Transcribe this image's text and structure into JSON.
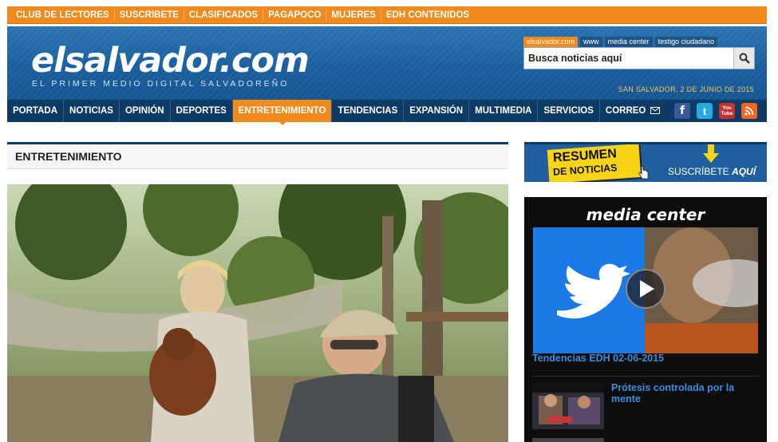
{
  "topbar": {
    "links": [
      "CLUB DE LECTORES",
      "SUSCRIBETE",
      "CLASIFICADOS",
      "PAGAPOCO",
      "MUJERES",
      "EDH CONTENIDOS"
    ]
  },
  "header": {
    "logo": "elsalvador.com",
    "slogan": "EL PRIMER MEDIO DIGITAL SALVADOREÑO",
    "site_tabs": [
      "elsalvador.com",
      "www",
      "media center",
      "testigo ciudadano"
    ],
    "search_placeholder": "Busca noticias aquí",
    "date": "SAN SALVADOR, 2 DE JUNIO DE 2015"
  },
  "nav": {
    "items": [
      "PORTADA",
      "NOTICIAS",
      "OPINIÓN",
      "DEPORTES",
      "ENTRETENIMIENTO",
      "TENDENCIAS",
      "EXPANSIÓN",
      "MULTIMEDIA",
      "SERVICIOS",
      "CORREO"
    ],
    "active": "ENTRETENIMIENTO",
    "social": [
      "f",
      "t",
      "You Tube",
      "rss"
    ]
  },
  "section": {
    "title": "ENTRETENIMIENTO"
  },
  "resumen": {
    "line1": "RESUMEN",
    "line2": "DE NOTICIAS",
    "cta_prefix": "SUSCRÍBETE",
    "cta_suffix": "AQUÍ"
  },
  "media_center": {
    "title": "media center",
    "video_caption": "Tendencias EDH 02-06-2015",
    "items": [
      {
        "title": "Prótesis controlada por la mente"
      }
    ]
  },
  "colors": {
    "orange": "#f08a1c",
    "navy": "#0e3b66",
    "blue": "#1a5f9f",
    "link_blue": "#3a8ee0"
  }
}
